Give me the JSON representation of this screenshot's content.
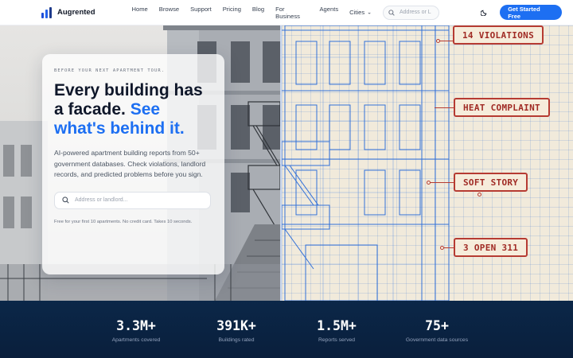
{
  "nav": {
    "logo": "Augrented",
    "links": [
      "Home",
      "Browse",
      "Support",
      "Pricing",
      "Blog",
      "For Business",
      "Agents"
    ],
    "cities_label": "Cities",
    "search_placeholder": "Address or L",
    "cta_label": "Get Started Free"
  },
  "hero": {
    "eyebrow": "BEFORE YOUR NEXT APARTMENT TOUR.",
    "headline_part1": "Every building has a facade.",
    "headline_accent": "See what's behind it.",
    "description": "AI-powered apartment building reports from 50+ government databases. Check violations, landlord records, and predicted problems before you sign.",
    "search_placeholder": "Address or landlord...",
    "fine_print": "Free for your first 10 apartments. No credit card. Takes 10 seconds.",
    "tags": [
      "14 VIOLATIONS",
      "HEAT COMPLAINT",
      "SOFT STORY",
      "3 OPEN 311"
    ]
  },
  "stats": [
    {
      "value": "3.3M+",
      "label": "Apartments covered"
    },
    {
      "value": "391K+",
      "label": "Buildings rated"
    },
    {
      "value": "1.5M+",
      "label": "Reports served"
    },
    {
      "value": "75+",
      "label": "Government data sources"
    }
  ],
  "colors": {
    "accent": "#1d6ff2",
    "tag_red": "#b63b32",
    "stats_bg": "#0b2748"
  }
}
